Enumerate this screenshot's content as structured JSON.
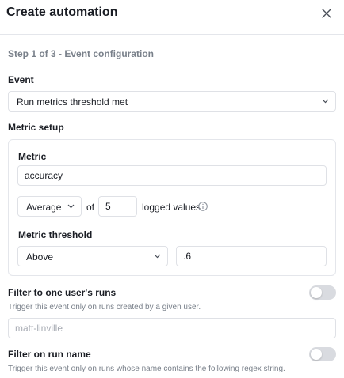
{
  "header": {
    "title": "Create automation",
    "close_icon": "close-icon"
  },
  "step": {
    "label": "Step 1 of 3 - Event configuration"
  },
  "event": {
    "label": "Event",
    "selected": "Run metrics threshold met"
  },
  "metric_setup": {
    "label": "Metric setup",
    "metric": {
      "label": "Metric",
      "value": "accuracy"
    },
    "aggregation": {
      "selected": "Average",
      "of_text": "of",
      "count_value": "5",
      "suffix": "logged values",
      "info_icon": "info-icon"
    },
    "threshold": {
      "label": "Metric threshold",
      "comparator": "Above",
      "value": ".6"
    }
  },
  "filter_user": {
    "label": "Filter to one user's runs",
    "description": "Trigger this event only on runs created by a given user.",
    "placeholder": "matt-linville",
    "enabled": false
  },
  "filter_run_name": {
    "label": "Filter on run name",
    "description": "Trigger this event only on runs whose name contains the following regex string.",
    "enabled": false
  },
  "colors": {
    "text": "#1a1d24",
    "muted": "#79808a",
    "border": "#dfe1e6",
    "toggle_off": "#d9dbe0"
  }
}
